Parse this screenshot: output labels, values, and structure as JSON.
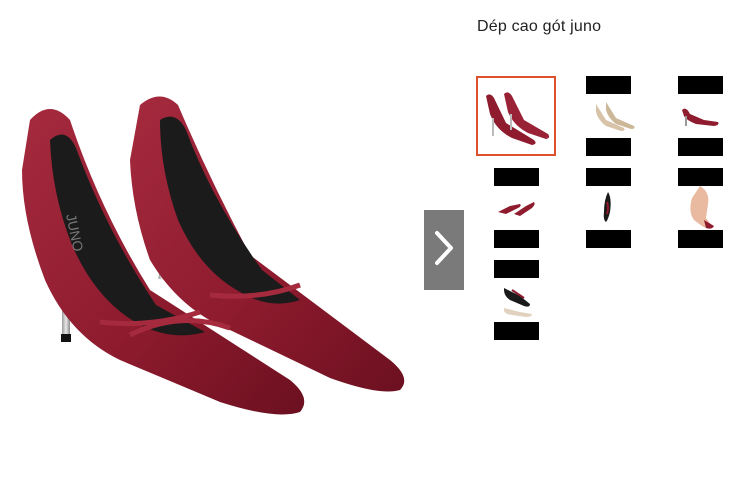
{
  "product": {
    "title": "Dép cao gót juno",
    "brand_mark": "JUNO"
  },
  "gallery": {
    "next_icon": "chevron-right-icon",
    "thumb_count": 7,
    "selected_index": 0,
    "colors": {
      "selected_border": "#e0512b",
      "shoe_red": "#8e1b2e",
      "nav_bg": "#7a7a7a"
    }
  }
}
